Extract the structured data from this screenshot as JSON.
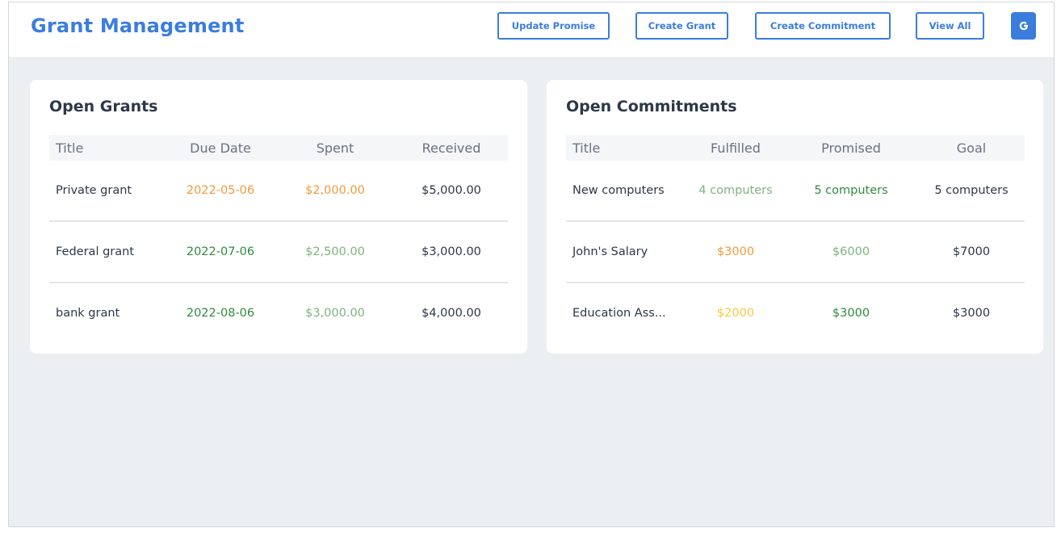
{
  "app": {
    "title": "Grant Management"
  },
  "nav": {
    "update_promise": "Update Promise",
    "create_grant": "Create Grant",
    "create_commitment": "Create Commitment",
    "view_all": "View All",
    "icon_glyph": "G"
  },
  "colors": {
    "accent": "#3b7ddd",
    "orange": "#f2993b",
    "dark_green": "#2f8a3e",
    "light_green": "#7fb37f",
    "yellow": "#f7c842"
  },
  "grants": {
    "title": "Open Grants",
    "columns": [
      "Title",
      "Due Date",
      "Spent",
      "Received"
    ],
    "rows": [
      {
        "title": "Private grant",
        "due": "2022-05-06",
        "spent": "$2,000.00",
        "received": "$5,000.00",
        "due_color": "orange",
        "spent_color": "orange"
      },
      {
        "title": "Federal grant",
        "due": "2022-07-06",
        "spent": "$2,500.00",
        "received": "$3,000.00",
        "due_color": "dark_green",
        "spent_color": "light_green"
      },
      {
        "title": "bank grant",
        "due": "2022-08-06",
        "spent": "$3,000.00",
        "received": "$4,000.00",
        "due_color": "dark_green",
        "spent_color": "light_green"
      }
    ]
  },
  "commitments": {
    "title": "Open Commitments",
    "columns": [
      "Title",
      "Fulfilled",
      "Promised",
      "Goal"
    ],
    "rows": [
      {
        "title": "New computers",
        "fulfilled": "4 computers",
        "promised": "5 computers",
        "goal": "5 computers",
        "fulfilled_color": "light_green",
        "promised_color": "dark_green"
      },
      {
        "title": "John's Salary",
        "fulfilled": "$3000",
        "promised": "$6000",
        "goal": "$7000",
        "fulfilled_color": "orange",
        "promised_color": "light_green"
      },
      {
        "title": "Education Ass...",
        "fulfilled": "$2000",
        "promised": "$3000",
        "goal": "$3000",
        "fulfilled_color": "yellow",
        "promised_color": "dark_green"
      }
    ]
  }
}
